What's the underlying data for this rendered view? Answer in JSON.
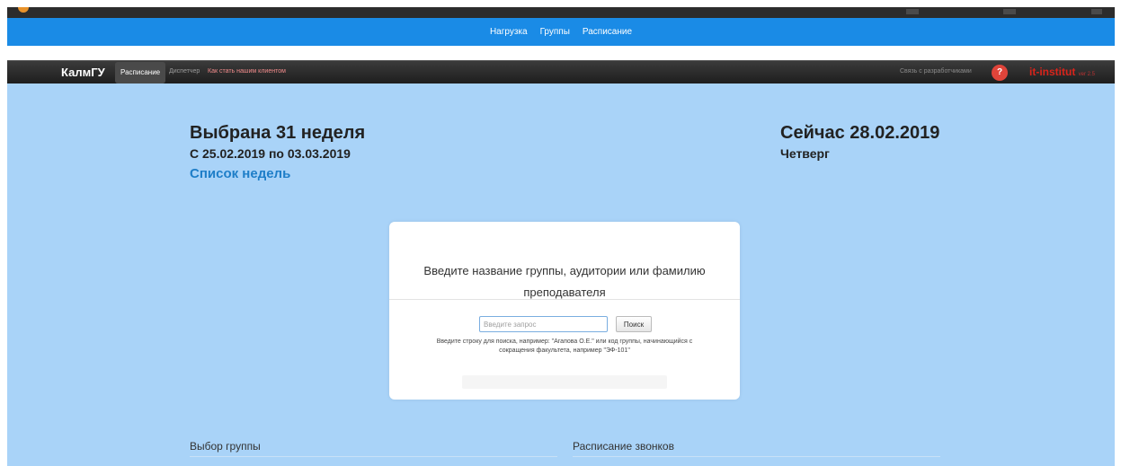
{
  "top_nav": {
    "items": [
      "Нагрузка",
      "Группы",
      "Расписание"
    ]
  },
  "navbar": {
    "brand": "КалмГУ",
    "items": [
      {
        "label": "Расписание",
        "active": true
      },
      {
        "label": "Диспетчер",
        "active": false
      },
      {
        "label": "Как стать нашим клиентом",
        "active": false
      }
    ],
    "contact": "Связь с разработчиками",
    "help_icon": "question-mark-icon",
    "help_text": "?",
    "logo": "it-institut",
    "version": "ver 2.5"
  },
  "week": {
    "title": "Выбрана 31 неделя",
    "range": "С 25.02.2019 по 03.03.2019",
    "list_link": "Список недель"
  },
  "now": {
    "date": "Сейчас 28.02.2019",
    "day": "Четверг"
  },
  "search": {
    "title": "Введите название группы, аудитории или фамилию преподавателя",
    "placeholder": "Введите запрос",
    "button": "Поиск",
    "hint": "Введите строку для поиска, например: \"Агапова О.Е.\" или код группы, начинающийся с сокращения факультета, например \"ЭФ-101\""
  },
  "sections": {
    "group_select": "Выбор группы",
    "bells": "Расписание звонков"
  },
  "colors": {
    "top_nav_bg": "#1a8be6",
    "navbar_bg": "#222222",
    "main_bg": "#a9d3f8",
    "link": "#1e7ec8",
    "logo": "#d9241b"
  }
}
